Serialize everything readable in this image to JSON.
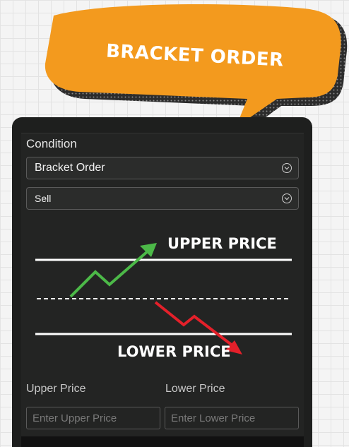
{
  "banner": {
    "title": "BRACKET ORDER"
  },
  "form": {
    "condition_label": "Condition",
    "order_type": "Bracket Order",
    "side": "Sell",
    "upper_price_label": "Upper Price",
    "lower_price_label": "Lower Price",
    "upper_price_placeholder": "Enter Upper Price",
    "lower_price_placeholder": "Enter Lower Price"
  },
  "diagram": {
    "upper_label": "UPPER PRICE",
    "lower_label": "LOWER PRICE",
    "up_arrow_color": "#4cb948",
    "down_arrow_color": "#e4202a"
  },
  "colors": {
    "bubble": "#f39a1e",
    "panel": "#1e1f1e"
  }
}
